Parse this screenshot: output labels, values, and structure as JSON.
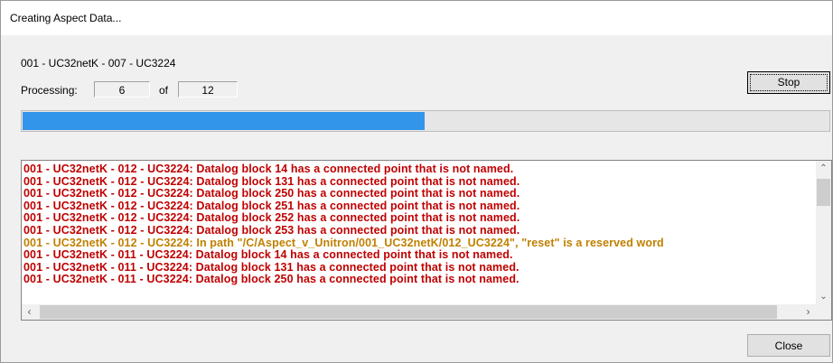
{
  "window": {
    "title": "Creating Aspect Data..."
  },
  "status": {
    "current_item": "001 - UC32netK - 007 - UC3224",
    "processing_label": "Processing:",
    "current": "6",
    "of_label": "of",
    "total": "12"
  },
  "progress": {
    "fraction": 0.5
  },
  "buttons": {
    "stop": "Stop",
    "close": "Close"
  },
  "colors": {
    "error": "#c00000",
    "warning": "#c08000",
    "progress": "#3395ea"
  },
  "log": [
    {
      "text": "001 - UC32netK - 012 - UC3224: Datalog block 14 has a connected point that is not named.",
      "level": "error"
    },
    {
      "text": "001 - UC32netK - 012 - UC3224: Datalog block 131 has a connected point that is not named.",
      "level": "error"
    },
    {
      "text": "001 - UC32netK - 012 - UC3224: Datalog block 250 has a connected point that is not named.",
      "level": "error"
    },
    {
      "text": "001 - UC32netK - 012 - UC3224: Datalog block 251 has a connected point that is not named.",
      "level": "error"
    },
    {
      "text": "001 - UC32netK - 012 - UC3224: Datalog block 252 has a connected point that is not named.",
      "level": "error"
    },
    {
      "text": "001 - UC32netK - 012 - UC3224: Datalog block 253 has a connected point that is not named.",
      "level": "error"
    },
    {
      "text": "001 - UC32netK - 012 - UC3224: In path \"/C/Aspect_v_Unitron/001_UC32netK/012_UC3224\", \"reset\" is a reserved word",
      "level": "warning"
    },
    {
      "text": "001 - UC32netK - 011 - UC3224: Datalog block 14 has a connected point that is not named.",
      "level": "error"
    },
    {
      "text": "001 - UC32netK - 011 - UC3224: Datalog block 131 has a connected point that is not named.",
      "level": "error"
    },
    {
      "text": "001 - UC32netK - 011 - UC3224: Datalog block 250 has a connected point that is not named.",
      "level": "error"
    }
  ]
}
